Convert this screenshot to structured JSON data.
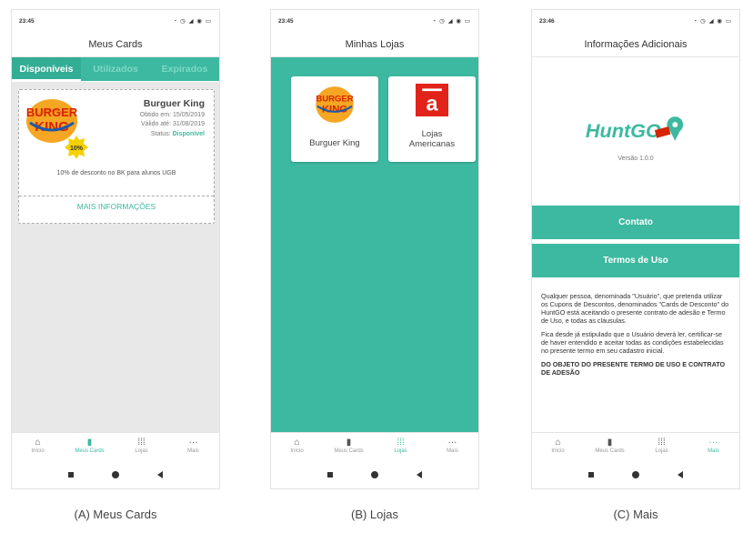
{
  "screens": {
    "a": {
      "time": "23:45",
      "status_icons": "◔ ◷ ◢ ◉ ▭",
      "title": "Meus Cards",
      "tabs": [
        "Disponíveis",
        "Utilizados",
        "Expirados"
      ],
      "card": {
        "name": "Burguer King",
        "obtained": "Obtido em: 15/05/2019",
        "valid": "Válido até: 31/08/2019",
        "status_label": "Status: ",
        "status_value": "Disponível",
        "badge": "10%",
        "logo_top": "BURGER",
        "logo_bottom": "KING",
        "description": "10% de desconto no BK para alunos UGB",
        "more": "MAIS INFORMAÇÕES"
      }
    },
    "b": {
      "time": "23:45",
      "status_icons": "◔ ◷ ◢ ◉ ▭",
      "title": "Minhas Lojas",
      "stores": [
        {
          "name": "Burguer King",
          "logo_top": "BURGER",
          "logo_bottom": "KING"
        },
        {
          "name_line1": "Lojas",
          "name_line2": "Americanas",
          "logo_letter": "a"
        }
      ]
    },
    "c": {
      "time": "23:46",
      "status_icons": "◔ ◷ ◢ ◉ ▭",
      "title": "Informações Adicionais",
      "logo_text": "HuntGO",
      "version": "Versão 1.0.0",
      "contact": "Contato",
      "terms_button": "Termos de Uso",
      "terms_p1": "Qualquer pessoa, denominada \"Usuário\", que pretenda utilizar os Cupons de Descontos, denominados \"Cards de Desconto\" do HuntGO está aceitando o presente contrato de adesão e Termo de Uso, e todas as cláusulas.",
      "terms_p2": "Fica desde já estipulado que o Usuário deverá ler, certificar-se de haver entendido e aceitar todas as condições estabelecidas no presente termo em seu cadastro inicial.",
      "terms_heading": "DO OBJETO DO PRESENTE TERMO DE USO E CONTRATO DE ADESÃO"
    }
  },
  "nav": {
    "inicio": "Início",
    "cards": "Meus Cards",
    "lojas": "Lojas",
    "mais": "Mais"
  },
  "nav_icons": {
    "inicio": "home-icon",
    "cards": "cards-icon",
    "lojas": "grid-icon",
    "mais": "more-dots-icon"
  },
  "captions": [
    "(A) Meus Cards",
    "(B) Lojas",
    "(C) Mais"
  ],
  "colors": {
    "accent": "#3cb9a0",
    "bk_red": "#d62300",
    "bk_blue": "#1e5aa8",
    "bk_yellow": "#f5a623",
    "americanas_red": "#e2231a"
  }
}
